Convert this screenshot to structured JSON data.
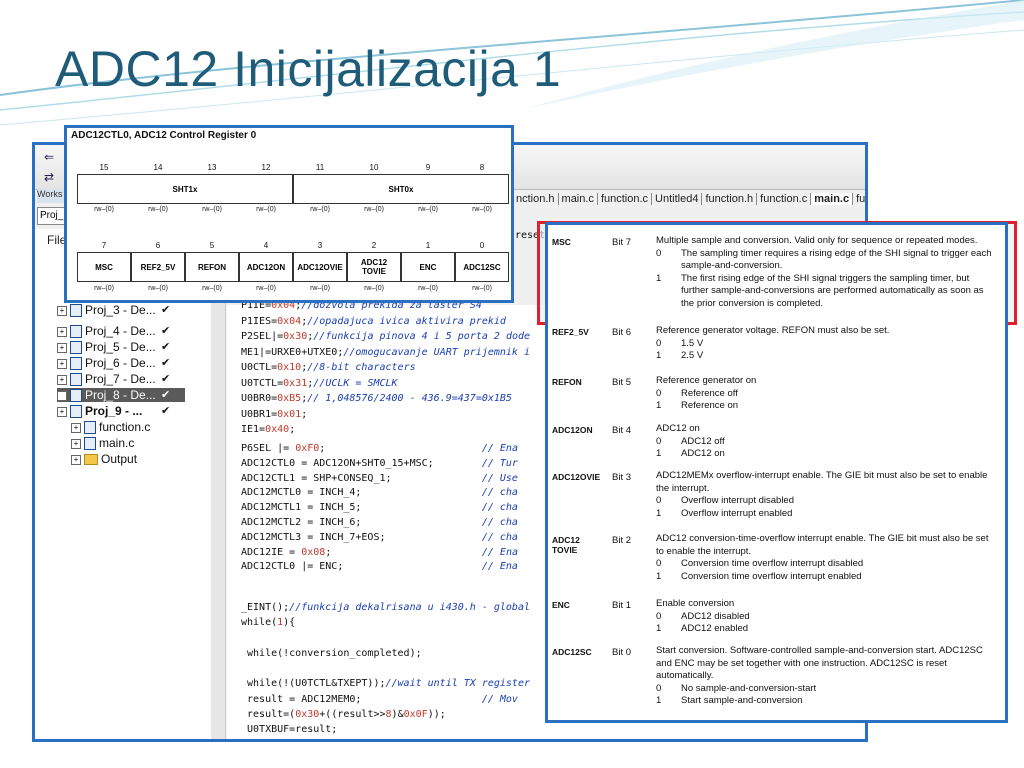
{
  "slide": {
    "title": "ADC12 Inicijalizacija 1",
    "accent": "#1f5c7a"
  },
  "ide": {
    "workspace_label": "Works",
    "project_combo": "Proj_",
    "files_header": "File",
    "tree": [
      {
        "label": "Proj_3 - De...",
        "check": "✔"
      },
      {
        "label": "Proj_4 - De...",
        "check": "✔"
      },
      {
        "label": "Proj_5 - De...",
        "check": "✔"
      },
      {
        "label": "Proj_6 - De...",
        "check": "✔"
      },
      {
        "label": "Proj_7 - De...",
        "check": "✔"
      },
      {
        "label": "Proj_8 - De...",
        "check": "✔"
      },
      {
        "label": "Proj_9 - ...",
        "check": "✔"
      },
      {
        "label": "function.c",
        "check": ""
      },
      {
        "label": "main.c",
        "check": ""
      },
      {
        "label": "Output",
        "check": ""
      }
    ],
    "tabs": [
      "nction.h",
      "main.c",
      "function.c",
      "Untitled4",
      "function.h",
      "function.c",
      "main.c",
      "functi"
    ],
    "active_tab": "main.c",
    "code_top": "P1IE=0x04;//dozvola prekida za taster S4\nP1IES=0x04;//opadajuca ivica aktivira prekid\nP2SEL|=0x30;//funkcija pinova 4 i 5 porta 2 dode\nME1|=URXE0+UTXE0;//omogucavanje UART prijemnik i\nU0CTL=0x10;//8-bit characters\nU0TCTL=0x31;//UCLK = SMCLK\nU0BR0=0xB5;// 1,048576/2400 - 436.9=437=0x1B5\nU0BR1=0x01;\nIE1=0x40;",
    "code_mid": "P6SEL |= 0xF0;                          // Ena\nADC12CTL0 = ADC12ON+SHT0_15+MSC;        // Tur\nADC12CTL1 = SHP+CONSEQ_1;               // Use\nADC12MCTL0 = INCH_4;                    // cha\nADC12MCTL1 = INCH_5;                    // cha\nADC12MCTL2 = INCH_6;                    // cha\nADC12MCTL3 = INCH_7+EOS;                // cha\nADC12IE = 0x08;                         // Ena\nADC12CTL0 |= ENC;                       // Ena",
    "code_bottom": "_EINT();//funkcija dekalrisana u i430.h - global\nwhile(1){\n\n while(!conversion_completed);\n\n while(!(U0TCTL&TXEPT));//wait until TX register\n result = ADC12MEM0;                    // Mov\n result=(0x30+((result>>8)&0x0F));\n U0TXBUF=result;",
    "code_reset_fragment": "reset"
  },
  "register": {
    "title": "ADC12CTL0, ADC12 Control Register 0",
    "upper_bits": [
      "15",
      "14",
      "13",
      "12",
      "11",
      "10",
      "9",
      "8"
    ],
    "upper_fields": [
      "SHT1x",
      "SHT0x"
    ],
    "lower_bits": [
      "7",
      "6",
      "5",
      "4",
      "3",
      "2",
      "1",
      "0"
    ],
    "lower_fields": [
      "MSC",
      "REF2_5V",
      "REFON",
      "ADC12ON",
      "ADC12OVIE",
      "ADC12\nTOVIE",
      "ENC",
      "ADC12SC"
    ],
    "rw": "rw–(0)"
  },
  "bits": [
    {
      "field": "MSC",
      "bit": "Bit 7",
      "text": "Multiple sample and conversion. Valid only for sequence or repeated modes.",
      "options": [
        [
          "0",
          "The sampling timer requires a rising edge of the SHI signal to trigger each sample-and-conversion."
        ],
        [
          "1",
          "The first rising edge of the SHI signal triggers the sampling timer, but further sample-and-conversions are performed automatically as soon as the prior conversion is completed."
        ]
      ]
    },
    {
      "field": "REF2_5V",
      "bit": "Bit 6",
      "text": "Reference generator voltage. REFON must also be set.",
      "options": [
        [
          "0",
          "1.5 V"
        ],
        [
          "1",
          "2.5 V"
        ]
      ]
    },
    {
      "field": "REFON",
      "bit": "Bit 5",
      "text": "Reference generator on",
      "options": [
        [
          "0",
          "Reference off"
        ],
        [
          "1",
          "Reference on"
        ]
      ]
    },
    {
      "field": "ADC12ON",
      "bit": "Bit 4",
      "text": "ADC12 on",
      "options": [
        [
          "0",
          "ADC12 off"
        ],
        [
          "1",
          "ADC12 on"
        ]
      ]
    },
    {
      "field": "ADC12OVIE",
      "bit": "Bit 3",
      "text": "ADC12MEMx overflow-interrupt enable. The GIE bit must also be set to enable the interrupt.",
      "options": [
        [
          "0",
          "Overflow interrupt disabled"
        ],
        [
          "1",
          "Overflow interrupt enabled"
        ]
      ]
    },
    {
      "field": "ADC12\nTOVIE",
      "bit": "Bit 2",
      "text": "ADC12 conversion-time-overflow interrupt enable. The GIE bit must also be set to enable the interrupt.",
      "options": [
        [
          "0",
          "Conversion time overflow interrupt disabled"
        ],
        [
          "1",
          "Conversion time overflow interrupt enabled"
        ]
      ]
    },
    {
      "field": "ENC",
      "bit": "Bit 1",
      "text": "Enable conversion",
      "options": [
        [
          "0",
          "ADC12 disabled"
        ],
        [
          "1",
          "ADC12 enabled"
        ]
      ]
    },
    {
      "field": "ADC12SC",
      "bit": "Bit 0",
      "text": "Start conversion. Software-controlled sample-and-conversion start. ADC12SC and ENC may be set together with one instruction. ADC12SC is reset automatically.",
      "options": [
        [
          "0",
          "No sample-and-conversion-start"
        ],
        [
          "1",
          "Start sample-and-conversion"
        ]
      ]
    }
  ]
}
